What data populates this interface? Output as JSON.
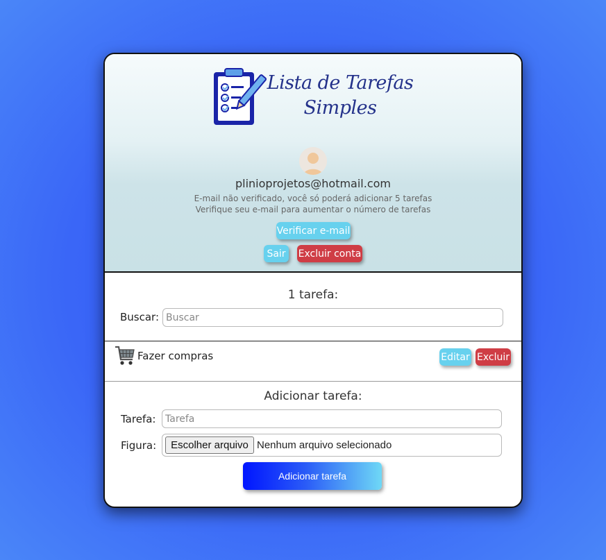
{
  "header": {
    "logo_line1": "Lista de Tarefas",
    "logo_line2": "Simples",
    "email": "plinioprojetos@hotmail.com",
    "note_line1": "E-mail não verificado, você só poderá adicionar 5 tarefas",
    "note_line2": "Verifique seu e-mail para aumentar o número de tarefas",
    "verify_label": "Verificar e-mail",
    "logout_label": "Sair",
    "delete_account_label": "Excluir conta"
  },
  "tasks_section": {
    "count_title": "1 tarefa:",
    "search_label": "Buscar:",
    "search_placeholder": "Buscar",
    "search_value": ""
  },
  "tasks": [
    {
      "name": "Fazer compras",
      "icon": "shopping-cart-icon",
      "edit_label": "Editar",
      "delete_label": "Excluir"
    }
  ],
  "add_section": {
    "title": "Adicionar tarefa:",
    "task_label": "Tarefa:",
    "task_placeholder": "Tarefa",
    "task_value": "",
    "figure_label": "Figura:",
    "file_button_label": "Escolher arquivo",
    "file_status": "Nenhum arquivo selecionado",
    "submit_label": "Adicionar tarefa"
  },
  "colors": {
    "cyan_button": "#67d1ee",
    "red_button": "#cf3d45",
    "logo_text": "#23318a",
    "page_background": "#3a66f7"
  }
}
